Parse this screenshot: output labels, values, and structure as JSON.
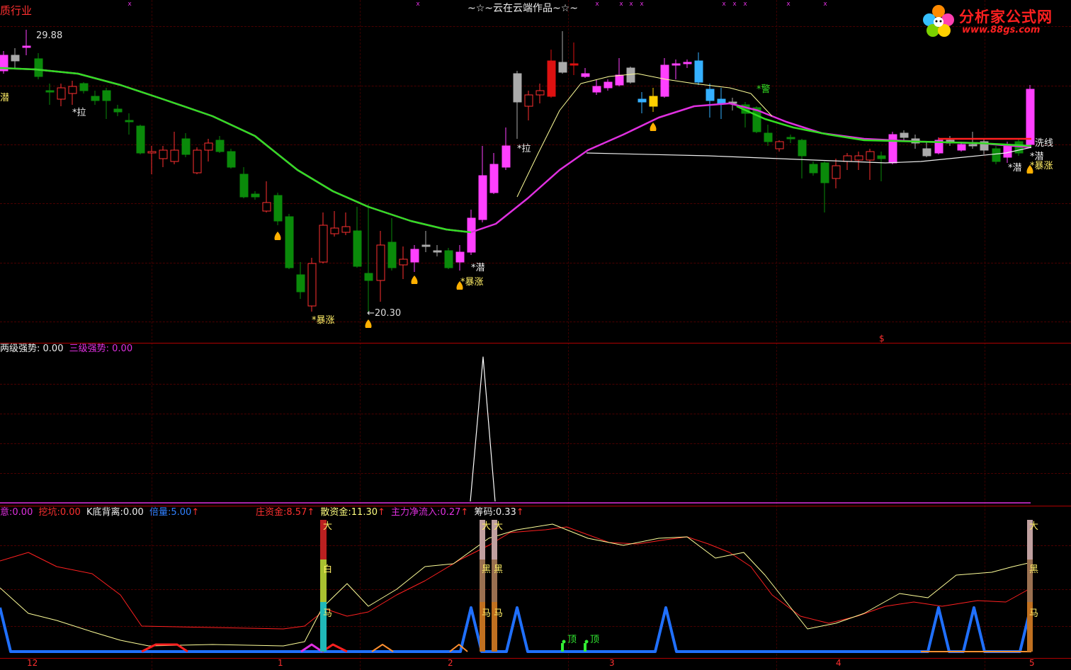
{
  "header": {
    "sector_label": "质行业",
    "title": "~☆~云在云端作品~☆~",
    "logo_text": "分析家公式网",
    "logo_url_text": "www.88gs.com"
  },
  "price_panel": {
    "high_label": "29.88",
    "low_label": "←20.30",
    "signals": [
      "潜",
      "*拉",
      "*暴涨",
      "*潜",
      "*暴涨",
      "*拉",
      "*警",
      "洗线",
      "*潜",
      "*潜",
      "*暴涨"
    ],
    "dollar_mark": "$"
  },
  "mid_panel": {
    "ind1_name": "两级强势:",
    "ind1_value": "0.00",
    "ind2_name": "三级强势:",
    "ind2_value": "0.00"
  },
  "bottom_panel": {
    "items": [
      {
        "name": "意:",
        "value": "0.00",
        "arrow": ""
      },
      {
        "name": "挖坑:",
        "value": "0.00",
        "arrow": ""
      },
      {
        "name": "K底背离:",
        "value": "0.00",
        "arrow": ""
      },
      {
        "name": "倍量:",
        "value": "5.00",
        "arrow": "↑"
      },
      {
        "name": "庄资金:",
        "value": "8.57",
        "arrow": "↑"
      },
      {
        "name": "散资金:",
        "value": "11.30",
        "arrow": "↑"
      },
      {
        "name": "主力净流入:",
        "value": "0.27",
        "arrow": "↑"
      },
      {
        "name": "筹码:",
        "value": "0.33",
        "arrow": "↑"
      }
    ],
    "bar_labels": [
      "大",
      "白",
      "马",
      "大",
      "大",
      "黑",
      "黑",
      "马",
      "马",
      "大",
      "黑",
      "马"
    ],
    "top_marks": [
      "顶",
      "顶"
    ]
  },
  "time_axis": {
    "labels": [
      "12",
      "1",
      "2",
      "3",
      "4",
      "5"
    ]
  },
  "colors": {
    "up": "#ff3030",
    "down": "#0a8a0a",
    "ma_green": "#33dd22",
    "ma_magenta": "#e030e0",
    "accent_yellow": "#ffff80"
  }
}
